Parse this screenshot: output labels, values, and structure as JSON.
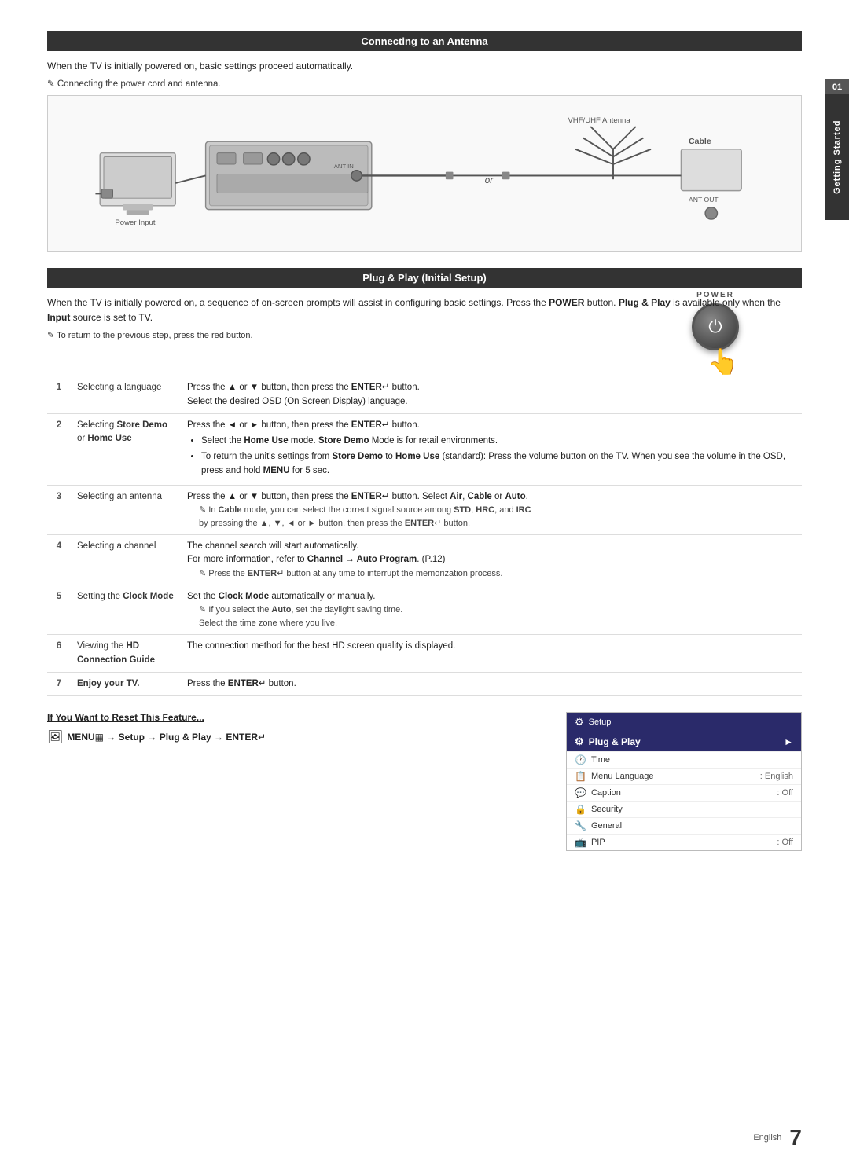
{
  "side_tab": {
    "number": "01",
    "label": "Getting Started"
  },
  "antenna_section": {
    "title": "Connecting to an Antenna",
    "intro": "When the TV is initially powered on, basic settings proceed automatically.",
    "note": "Connecting the power cord and antenna.",
    "diagram_labels": {
      "power_input": "Power Input",
      "vhf_uhf": "VHF/UHF Antenna",
      "cable": "Cable",
      "ant_out": "ANT OUT",
      "or": "or"
    }
  },
  "plug_section": {
    "title": "Plug & Play (Initial Setup)",
    "intro": "When the TV is initially powered on, a sequence of on-screen prompts will assist in configuring basic settings. Press the POWER button. Plug & Play is available only when the Input source is set to TV.",
    "note": "To return to the previous step, press the red button.",
    "steps": [
      {
        "num": "1",
        "label": "Selecting a language",
        "desc": "Press the ▲ or ▼ button, then press the ENTER button. Select the desired OSD (On Screen Display) language."
      },
      {
        "num": "2",
        "label": "Selecting Store Demo or Home Use",
        "desc_main": "Press the ◄ or ► button, then press the ENTER button.",
        "bullets": [
          "Select the Home Use mode. Store Demo Mode is for retail environments.",
          "To return the unit's settings from Store Demo to Home Use (standard): Press the volume button on the TV. When you see the volume in the OSD, press and hold MENU for 5 sec."
        ]
      },
      {
        "num": "3",
        "label": "Selecting an antenna",
        "desc": "Press the ▲ or ▼ button, then press the ENTER button. Select Air, Cable or Auto.",
        "note": "In Cable mode, you can select the correct signal source among STD, HRC, and IRC by pressing the ▲, ▼, ◄ or ► button, then press the ENTER button."
      },
      {
        "num": "4",
        "label": "Selecting a channel",
        "desc": "The channel search will start automatically. For more information, refer to Channel → Auto Program. (P.12)",
        "note": "Press the ENTER button at any time to interrupt the memorization process."
      },
      {
        "num": "5",
        "label": "Setting the Clock Mode",
        "desc": "Set the Clock Mode automatically or manually.",
        "note": "If you select the Auto, set the daylight saving time. Select the time zone where you live."
      },
      {
        "num": "6",
        "label": "Viewing the HD Connection Guide",
        "desc": "The connection method for the best HD screen quality is displayed."
      },
      {
        "num": "7",
        "label": "Enjoy your TV.",
        "desc": "Press the ENTER button."
      }
    ]
  },
  "reset_section": {
    "title": "If You Want to Reset This Feature...",
    "command": "MENU → Setup → Plug & Play → ENTER"
  },
  "osd_menu": {
    "header_icon": "⚙",
    "header_label": "Plug & Play",
    "rows": [
      {
        "icon": "🔧",
        "label": "Time",
        "value": ""
      },
      {
        "icon": "📋",
        "label": "Menu Language",
        "value": ": English"
      },
      {
        "icon": "💬",
        "label": "Caption",
        "value": ": Off"
      },
      {
        "icon": "",
        "label": "Security",
        "value": ""
      },
      {
        "icon": "",
        "label": "General",
        "value": ""
      },
      {
        "icon": "",
        "label": "PIP",
        "value": ": Off"
      }
    ]
  },
  "footer": {
    "lang": "English",
    "page": "7"
  }
}
